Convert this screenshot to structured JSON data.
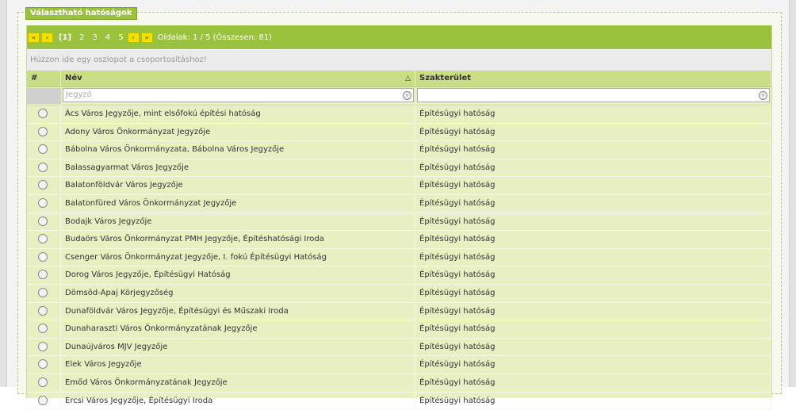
{
  "legend": "Választható hatóságok",
  "pager": {
    "buttons": [
      "«",
      "‹",
      "›",
      "»"
    ],
    "pages": [
      "[1]",
      "2",
      "3",
      "4",
      "5"
    ],
    "info": "Oldalak: 1 / 5 (Összesen: 81)"
  },
  "group_panel": "Húzzon ide egy oszlopot a csoportosításhoz!",
  "columns": {
    "hash": "#",
    "name": "Név",
    "sort_icon": "△",
    "area": "Szakterület"
  },
  "filter": {
    "name_value": "Jegyző",
    "area_value": ""
  },
  "rows": [
    {
      "name": "Ács Város Jegyzője, mint elsőfokú építési hatóság",
      "area": "Építésügyi hatóság"
    },
    {
      "name": "Adony Város Önkormányzat Jegyzője",
      "area": "Építésügyi hatóság"
    },
    {
      "name": "Bábolna Város Önkormányzata, Bábolna Város Jegyzője",
      "area": "Építésügyi hatóság"
    },
    {
      "name": "Balassagyarmat Város Jegyzője",
      "area": "Építésügyi hatóság"
    },
    {
      "name": "Balatonföldvár Város Jegyzője",
      "area": "Építésügyi hatóság"
    },
    {
      "name": "Balatonfüred Város Önkormányzat Jegyzője",
      "area": "Építésügyi hatóság"
    },
    {
      "name": "Bodajk Város Jegyzője",
      "area": "Építésügyi hatóság"
    },
    {
      "name": "Budaörs Város Önkormányzat PMH Jegyzője, Építéshatósági Iroda",
      "area": "Építésügyi hatóság"
    },
    {
      "name": "Csenger Város Önkormányzat Jegyzője, I. fokú Építésügyi Hatóság",
      "area": "Építésügyi hatóság"
    },
    {
      "name": "Dorog Város Jegyzője, Építésügyi Hatóság",
      "area": "Építésügyi hatóság"
    },
    {
      "name": "Dömsöd-Apaj Körjegyzőség",
      "area": "Építésügyi hatóság"
    },
    {
      "name": "Dunaföldvár Város Jegyzője, Építésügyi és Műszaki Iroda",
      "area": "Építésügyi hatóság"
    },
    {
      "name": "Dunaharaszti Város Önkormányzatának Jegyzője",
      "area": "Építésügyi hatóság"
    },
    {
      "name": "Dunaújváros MJV Jegyzője",
      "area": "Építésügyi hatóság"
    },
    {
      "name": "Elek Város Jegyzője",
      "area": "Építésügyi hatóság"
    },
    {
      "name": "Emőd Város Önkormányzatának Jegyzője",
      "area": "Építésügyi hatóság"
    },
    {
      "name": "Ercsi Város Jegyzője, Építésügyi Iroda",
      "area": "Építésügyi hatóság"
    }
  ]
}
